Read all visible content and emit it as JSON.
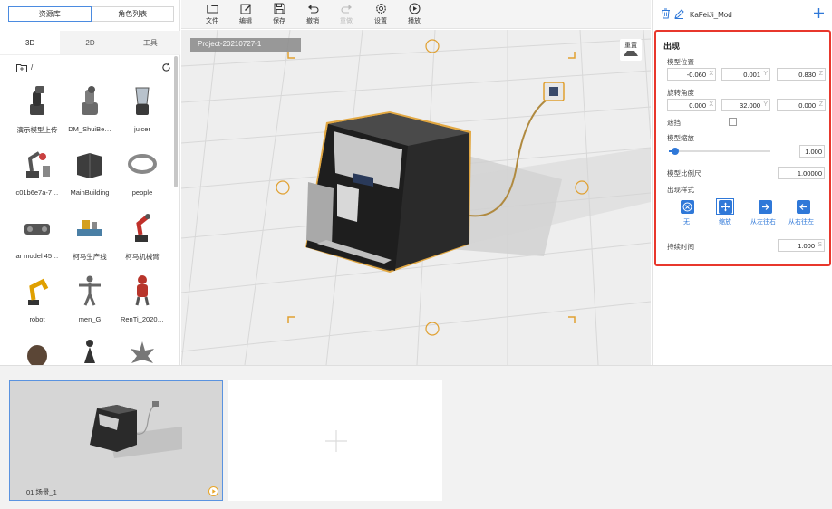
{
  "left_panel": {
    "top_tabs": [
      "资源库",
      "角色列表"
    ],
    "category_tabs": [
      "3D",
      "2D",
      "工具"
    ],
    "path": "/",
    "assets": [
      {
        "label": "演示模型上传",
        "icon": "robot-arm-dark"
      },
      {
        "label": "DM_ShuiBe…",
        "icon": "robot-arm-gray"
      },
      {
        "label": "juicer",
        "icon": "juicer"
      },
      {
        "label": "c01b6e7a-7…",
        "icon": "industrial-robot"
      },
      {
        "label": "MainBuilding",
        "icon": "building"
      },
      {
        "label": "people",
        "icon": "ring"
      },
      {
        "label": "ar model 45…",
        "icon": "machine"
      },
      {
        "label": "柯马生产线",
        "icon": "production-line"
      },
      {
        "label": "柯马机械臂",
        "icon": "red-robot-arm"
      },
      {
        "label": "robot",
        "icon": "yellow-robot"
      },
      {
        "label": "men_G",
        "icon": "man-figure"
      },
      {
        "label": "RenTi_2020…",
        "icon": "red-figure"
      },
      {
        "label": "",
        "icon": "creature"
      },
      {
        "label": "",
        "icon": "figure-dark"
      },
      {
        "label": "",
        "icon": "spiky"
      }
    ]
  },
  "toolbar": {
    "items": [
      {
        "label": "文件",
        "icon": "folder-icon",
        "enabled": true
      },
      {
        "label": "编辑",
        "icon": "edit-icon",
        "enabled": true
      },
      {
        "label": "保存",
        "icon": "save-icon",
        "enabled": true
      },
      {
        "label": "撤销",
        "icon": "undo-icon",
        "enabled": true
      },
      {
        "label": "重做",
        "icon": "redo-icon",
        "enabled": false
      },
      {
        "label": "设置",
        "icon": "settings-icon",
        "enabled": true
      },
      {
        "label": "播放",
        "icon": "play-icon",
        "enabled": true
      }
    ]
  },
  "viewport": {
    "project_label": "Project-20210727-1",
    "reset_label": "重置"
  },
  "right_panel": {
    "model_name": "KaFeiJi_Mod",
    "section_title": "出现",
    "position_label": "模型位置",
    "position": {
      "x": "-0.060",
      "y": "0.001",
      "z": "0.830"
    },
    "rotation_label": "旋转角度",
    "rotation": {
      "x": "0.000",
      "y": "32.000",
      "z": "0.000"
    },
    "occlusion_label": "遮挡",
    "occlusion_checked": false,
    "scale_label": "模型缩放",
    "scale_value": "1.000",
    "scale_slider_fraction": 0.08,
    "ratio_label": "模型比例尺",
    "ratio_value": "1.00000",
    "style_label": "出现样式",
    "styles": [
      "无",
      "缩放",
      "从左往右",
      "从右往左"
    ],
    "selected_style": "缩放",
    "duration_label": "持续时间",
    "duration_value": "1.000",
    "duration_unit": "S",
    "accent_color": "#2f78d8",
    "highlight_border_color": "#e8372c"
  },
  "scenes": {
    "items": [
      {
        "label": "01  场景_1"
      }
    ]
  }
}
